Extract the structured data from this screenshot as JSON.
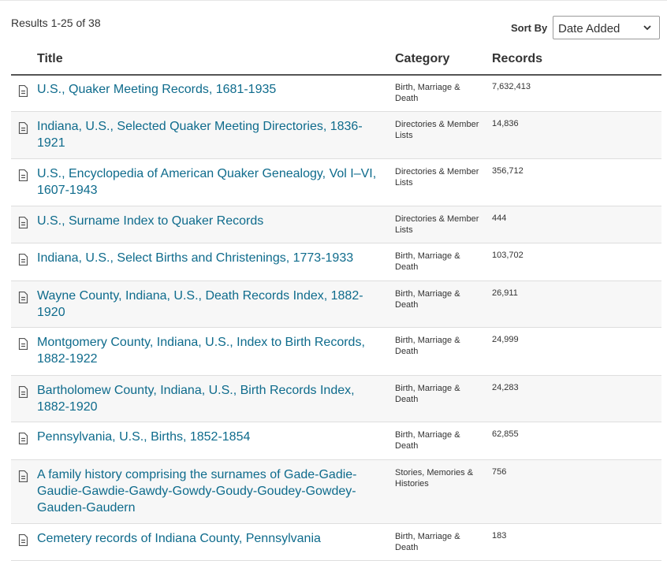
{
  "header": {
    "results_text": "Results 1-25 of 38",
    "sort_label": "Sort By",
    "sort_value": "Date Added"
  },
  "table": {
    "columns": [
      "Title",
      "Category",
      "Records"
    ],
    "rows": [
      {
        "title": "U.S., Quaker Meeting Records, 1681-1935",
        "category": "Birth, Marriage & Death",
        "records": "7,632,413"
      },
      {
        "title": "Indiana, U.S., Selected Quaker Meeting Directories, 1836-1921",
        "category": "Directories & Member Lists",
        "records": "14,836"
      },
      {
        "title": "U.S., Encyclopedia of American Quaker Genealogy, Vol I–VI, 1607-1943",
        "category": "Directories & Member Lists",
        "records": "356,712"
      },
      {
        "title": "U.S., Surname Index to Quaker Records",
        "category": "Directories & Member Lists",
        "records": "444"
      },
      {
        "title": "Indiana, U.S., Select Births and Christenings, 1773-1933",
        "category": "Birth, Marriage & Death",
        "records": "103,702"
      },
      {
        "title": "Wayne County, Indiana, U.S., Death Records Index, 1882-1920",
        "category": "Birth, Marriage & Death",
        "records": "26,911"
      },
      {
        "title": "Montgomery County, Indiana, U.S., Index to Birth Records, 1882-1922",
        "category": "Birth, Marriage & Death",
        "records": "24,999"
      },
      {
        "title": "Bartholomew County, Indiana, U.S., Birth Records Index, 1882-1920",
        "category": "Birth, Marriage & Death",
        "records": "24,283"
      },
      {
        "title": "Pennsylvania, U.S., Births, 1852-1854",
        "category": "Birth, Marriage & Death",
        "records": "62,855"
      },
      {
        "title": "A family history comprising the surnames of Gade-Gadie-Gaudie-Gawdie-Gawdy-Gowdy-Goudy-Goudey-Gowdey-Gauden-Gaudern",
        "category": "Stories, Memories & Histories",
        "records": "756"
      },
      {
        "title": "Cemetery records of Indiana County, Pennsylvania",
        "category": "Birth, Marriage & Death",
        "records": "183"
      }
    ]
  },
  "icons": {
    "row_icon": "document-icon",
    "select_icon": "chevron-down-icon"
  },
  "colors": {
    "link": "#0e6b8c",
    "alt_row": "#f7f7f7",
    "divider": "#dedede",
    "header_rule": "#555555"
  }
}
